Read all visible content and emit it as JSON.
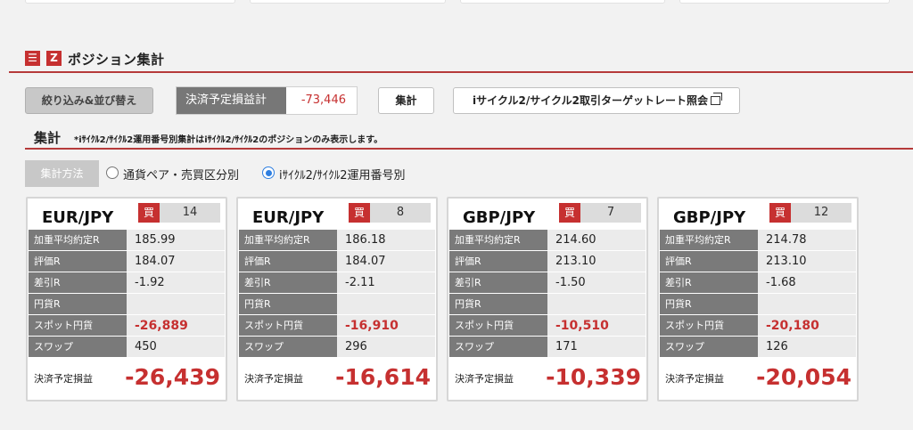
{
  "section": {
    "menu_icon": "☰",
    "z_icon": "Z",
    "title": "ポジション集計"
  },
  "toolbar": {
    "filter_label": "絞り込み&並び替え",
    "pl_label": "決済予定損益計",
    "pl_value": "-73,446",
    "total_label": "集計",
    "rate_label": "iサイクル2/サイクル2取引ターゲットレート照会"
  },
  "summary": {
    "title": "集計",
    "note": "*iｻｲｸﾙ2/ｻｲｸﾙ2運用番号別集計はiｻｲｸﾙ2/ｻｲｸﾙ2のポジションのみ表示します。"
  },
  "method": {
    "label": "集計方法",
    "options": [
      {
        "label": "通貨ペア・売買区分別",
        "selected": false
      },
      {
        "label": "iｻｲｸﾙ2/ｻｲｸﾙ2運用番号別",
        "selected": true
      }
    ]
  },
  "row_labels": [
    "加重平均約定R",
    "評価R",
    "差引R",
    "円貨R",
    "スポット円貨",
    "スワップ"
  ],
  "total_label": "決済予定損益",
  "accent_color": "#c63030",
  "cards": [
    {
      "pair": "EUR/JPY",
      "side": "買",
      "qty": "14",
      "avg": "185.99",
      "eval": "184.07",
      "diff": "-1.92",
      "yen": "",
      "spot": "-26,889",
      "swap": "450",
      "total": "-26,439"
    },
    {
      "pair": "EUR/JPY",
      "side": "買",
      "qty": "8",
      "avg": "186.18",
      "eval": "184.07",
      "diff": "-2.11",
      "yen": "",
      "spot": "-16,910",
      "swap": "296",
      "total": "-16,614"
    },
    {
      "pair": "GBP/JPY",
      "side": "買",
      "qty": "7",
      "avg": "214.60",
      "eval": "213.10",
      "diff": "-1.50",
      "yen": "",
      "spot": "-10,510",
      "swap": "171",
      "total": "-10,339"
    },
    {
      "pair": "GBP/JPY",
      "side": "買",
      "qty": "12",
      "avg": "214.78",
      "eval": "213.10",
      "diff": "-1.68",
      "yen": "",
      "spot": "-20,180",
      "swap": "126",
      "total": "-20,054"
    }
  ]
}
